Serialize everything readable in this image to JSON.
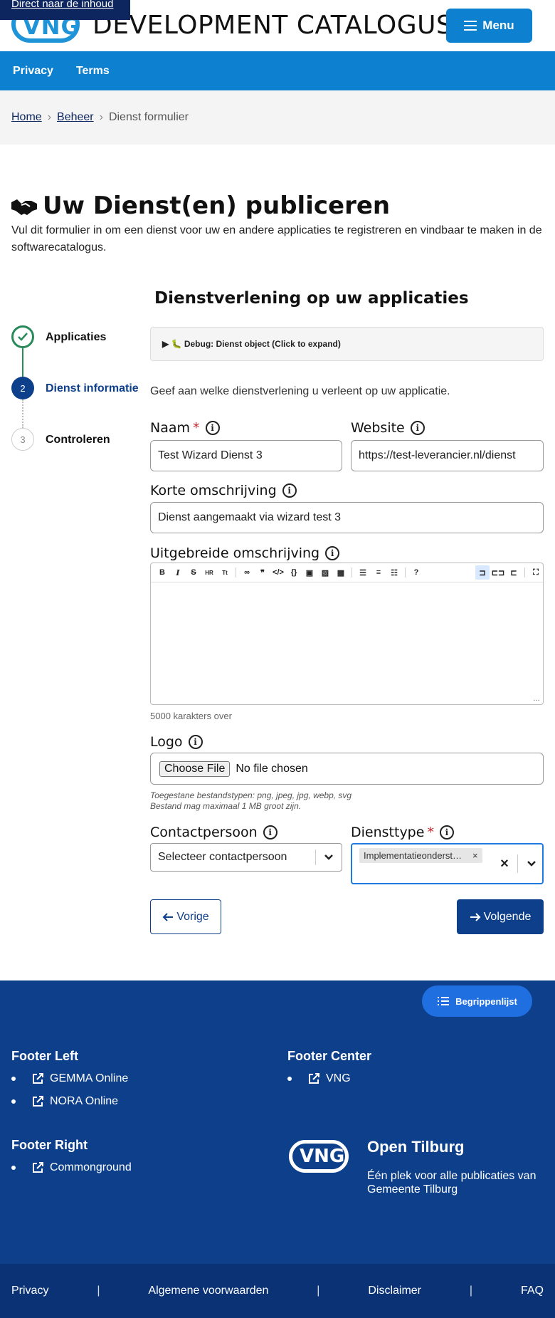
{
  "header": {
    "skip_link": "Direct naar de inhoud",
    "logo_text": "VNG",
    "site_title": "DEVELOPMENT CATALOGUS",
    "menu_label": "Menu"
  },
  "topnav": {
    "items": [
      {
        "label": "Privacy"
      },
      {
        "label": "Terms"
      }
    ]
  },
  "breadcrumb": {
    "home": "Home",
    "beheer": "Beheer",
    "current": "Dienst formulier"
  },
  "intro": {
    "title": "Uw Dienst(en) publiceren",
    "description": "Vul dit formulier in om een dienst voor uw en andere applicaties te registreren en vindbaar te maken in de softwarecatalogus."
  },
  "section_title": "Dienstverlening op uw applicaties",
  "stepper": {
    "steps": [
      {
        "number": "1",
        "label": "Applicaties",
        "state": "done"
      },
      {
        "number": "2",
        "label": "Dienst informatie",
        "state": "active"
      },
      {
        "number": "3",
        "label": "Controleren",
        "state": "pending"
      }
    ]
  },
  "form": {
    "debug_label": "▶ 🐛 Debug: Dienst object (Click to expand)",
    "description": "Geef aan welke dienstverlening u verleent op uw applicatie.",
    "naam": {
      "label": "Naam",
      "value": "Test Wizard Dienst 3"
    },
    "website": {
      "label": "Website",
      "value": "https://test-leverancier.nl/dienst"
    },
    "korte": {
      "label": "Korte omschrijving",
      "value": "Dienst aangemaakt via wizard test 3"
    },
    "uitgebreide": {
      "label": "Uitgebreide omschrijving",
      "value": "",
      "char_count": "5000 karakters over"
    },
    "logo": {
      "label": "Logo",
      "button": "Choose File",
      "status": "No file chosen",
      "hint1": "Toegestane bestandstypen: png, jpeg, jpg, webp, svg",
      "hint2": "Bestand mag maximaal 1 MB groot zijn."
    },
    "contact": {
      "label": "Contactpersoon",
      "placeholder": "Selecteer contactpersoon"
    },
    "diensttype": {
      "label": "Diensttype",
      "selected_tag": "Implementatieondersteuning"
    },
    "prev_label": "Vorige",
    "next_label": "Volgende"
  },
  "footer": {
    "glossary_label": "Begrippenlijst",
    "left": {
      "title": "Footer Left",
      "links": [
        "GEMMA Online",
        "NORA Online"
      ]
    },
    "center": {
      "title": "Footer Center",
      "links": [
        "VNG"
      ]
    },
    "right": {
      "title": "Footer Right",
      "links": [
        "Commonground"
      ]
    },
    "org": {
      "logo_text": "VNG",
      "name": "Open Tilburg",
      "description": "Één plek voor alle publicaties van Gemeente Tilburg"
    },
    "bottom_links": [
      "Privacy",
      "Algemene voorwaarden",
      "Disclaimer",
      "FAQ"
    ],
    "separator": "|"
  },
  "colors": {
    "brand_blue": "#0d81d0",
    "dark_blue": "#0d3f8a",
    "success_green": "#2a8a5a",
    "required_red": "#c0262d"
  }
}
